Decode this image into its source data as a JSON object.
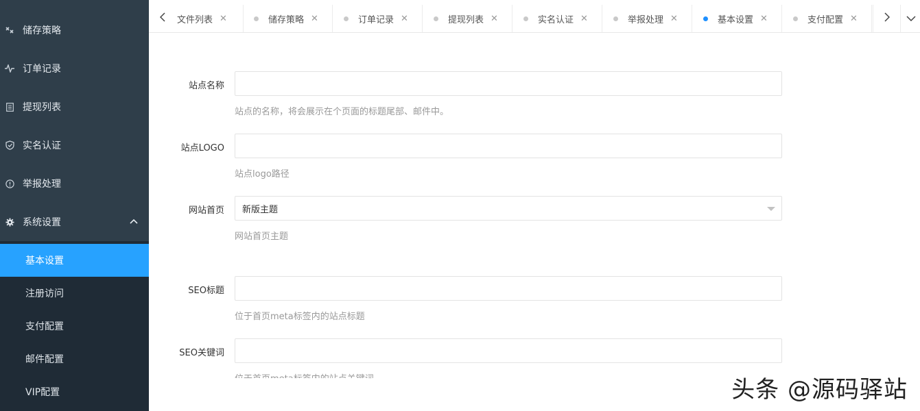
{
  "sidebar": {
    "items": [
      {
        "label": "储存策略",
        "icon": "storage-strategy-icon"
      },
      {
        "label": "订单记录",
        "icon": "pulse-icon"
      },
      {
        "label": "提现列表",
        "icon": "clipboard-icon"
      },
      {
        "label": "实名认证",
        "icon": "shield-check-icon"
      },
      {
        "label": "举报处理",
        "icon": "info-circle-icon"
      },
      {
        "label": "系统设置",
        "icon": "gear-icon"
      }
    ],
    "submenu": [
      {
        "label": "基本设置",
        "active": true
      },
      {
        "label": "注册访问"
      },
      {
        "label": "支付配置"
      },
      {
        "label": "邮件配置"
      },
      {
        "label": "VIP配置"
      }
    ]
  },
  "tabs": [
    {
      "label": "文件列表"
    },
    {
      "label": "储存策略"
    },
    {
      "label": "订单记录"
    },
    {
      "label": "提现列表"
    },
    {
      "label": "实名认证"
    },
    {
      "label": "举报处理"
    },
    {
      "label": "基本设置",
      "active": true
    },
    {
      "label": "支付配置"
    }
  ],
  "form": {
    "site_name": {
      "label": "站点名称",
      "value": "",
      "help": "站点的名称，将会展示在个页面的标题尾部、邮件中。"
    },
    "site_logo": {
      "label": "站点LOGO",
      "value": "",
      "help": "站点logo路径"
    },
    "home_page": {
      "label": "网站首页",
      "value": "新版主题",
      "help": "网站首页主题"
    },
    "seo_title": {
      "label": "SEO标题",
      "value": "",
      "help": "位于首页meta标签内的站点标题"
    },
    "seo_keywords": {
      "label": "SEO关键词",
      "value": "",
      "help": "位于首页meta标签内的站点关键词"
    }
  },
  "watermark": "头条 @源码驿站",
  "colors": {
    "sidebar_bg": "#2f3e4a",
    "submenu_bg": "#1f2b36",
    "accent": "#27a2ff"
  }
}
